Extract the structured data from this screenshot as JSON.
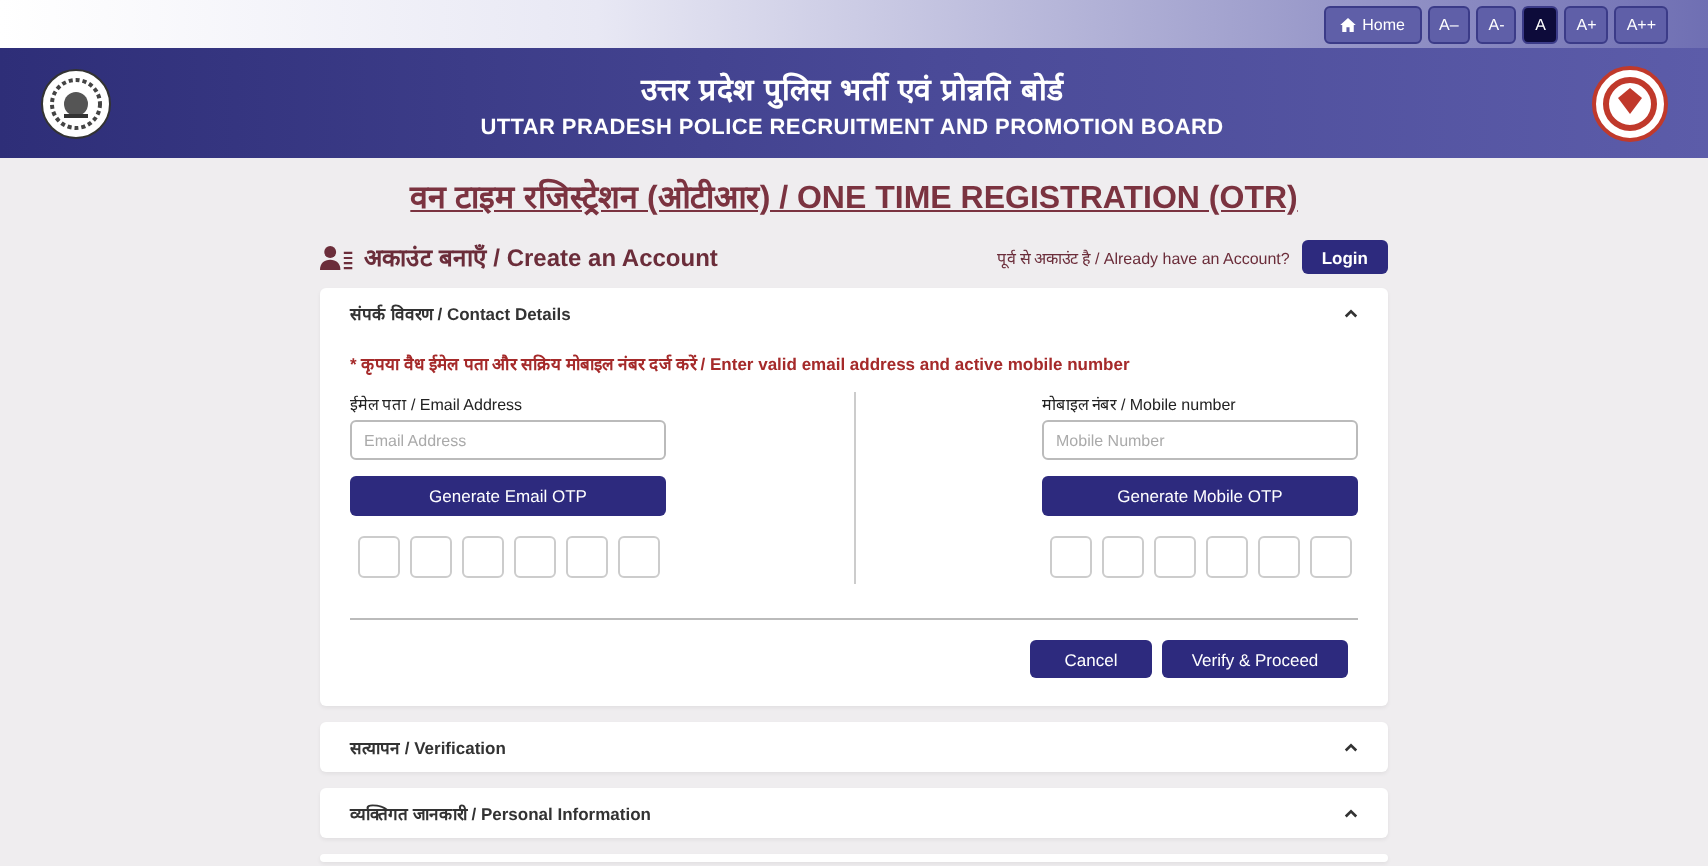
{
  "toolbar": {
    "home": "Home",
    "font_sizes": [
      {
        "label": "A–",
        "selected": false
      },
      {
        "label": "A-",
        "selected": false
      },
      {
        "label": "A",
        "selected": true
      },
      {
        "label": "A+",
        "selected": false
      },
      {
        "label": "A++",
        "selected": false
      }
    ]
  },
  "header": {
    "title_hindi": "उत्तर प्रदेश पुलिस भर्ती एवं प्रोन्नति बोर्ड",
    "title_english": "UTTAR PRADESH POLICE RECRUITMENT AND PROMOTION BOARD"
  },
  "page_title": "वन टाइम रजिस्ट्रेशन (ओटीआर) / ONE TIME REGISTRATION (OTR)",
  "create_account": {
    "heading": "अकाउंट बनाएँ / Create an Account",
    "login_prompt": "पूर्व से अकाउंट है / Already have an Account?",
    "login_button": "Login"
  },
  "sections": [
    {
      "title": "संपर्क विवरण / Contact Details",
      "expanded": true,
      "notice": "* कृपया वैध ईमेल पता और सक्रिय मोबाइल नंबर दर्ज करें / Enter valid email address and active mobile number",
      "columns": [
        {
          "label": "ईमेल पता / Email Address",
          "placeholder": "Email Address",
          "button": "Generate Email OTP",
          "otp_boxes": [
            {
              "kind": "digit"
            },
            {
              "kind": "digit"
            },
            {
              "kind": "digit"
            },
            {
              "kind": "digit"
            },
            {
              "kind": "digit"
            },
            {
              "kind": "digit"
            }
          ]
        },
        {
          "label": "मोबाइल नंबर / Mobile number",
          "placeholder": "Mobile Number",
          "button": "Generate Mobile OTP",
          "otp_boxes": [
            {
              "kind": "digit"
            },
            {
              "kind": "digit"
            },
            {
              "kind": "digit"
            },
            {
              "kind": "digit"
            },
            {
              "kind": "digit"
            },
            {
              "kind": "digit"
            }
          ]
        }
      ],
      "actions": [
        {
          "label": "Cancel"
        },
        {
          "label": "Verify & Proceed"
        }
      ]
    },
    {
      "title": "सत्यापन / Verification",
      "expanded": false
    },
    {
      "title": "व्यक्तिगत जानकारी / Personal Information",
      "expanded": false
    }
  ]
}
